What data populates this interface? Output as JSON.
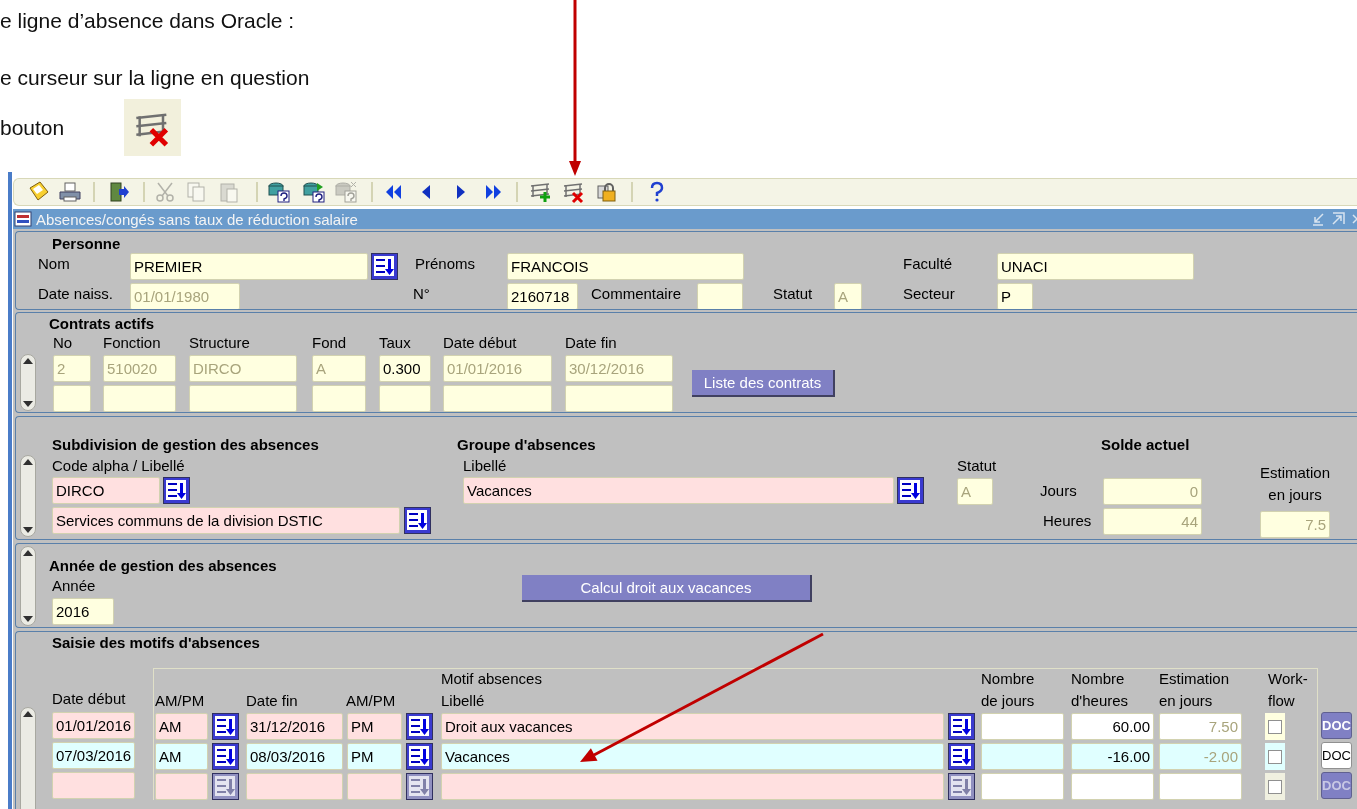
{
  "doc": {
    "lines": [
      "e ligne d’absence dans Oracle :",
      "e curseur sur la ligne en  question",
      "bouton"
    ]
  },
  "toolbar": [
    {
      "disabled": false
    },
    {
      "disabled": false
    },
    {
      "disabled": false
    },
    {
      "disabled": true
    },
    {
      "disabled": true
    },
    {
      "disabled": true
    },
    {
      "disabled": false
    },
    {
      "disabled": false
    },
    {
      "disabled": true
    },
    {
      "disabled": false
    },
    {
      "disabled": false
    },
    {
      "disabled": false
    },
    {
      "disabled": false
    },
    {
      "disabled": false
    },
    {
      "disabled": false
    },
    {
      "disabled": false
    },
    {
      "disabled": false
    }
  ],
  "window": {
    "title": "Absences/congés sans taux de réduction salaire"
  },
  "personne": {
    "title": "Personne",
    "fields": [
      {
        "label": "Nom",
        "value": "PREMIER",
        "kind": "optional",
        "disabled": false
      },
      {
        "label": "Prénoms",
        "value": "FRANCOIS",
        "kind": "optional",
        "disabled": false
      },
      {
        "label": "Faculté",
        "value": "UNACI",
        "kind": "optional",
        "disabled": false
      },
      {
        "label": "Date naiss.",
        "value": "01/01/1980",
        "kind": "optional",
        "disabled": true
      },
      {
        "label": "N°",
        "value": "2160718",
        "kind": "optional",
        "disabled": false
      },
      {
        "label": "Commentaire",
        "kind": "optional"
      },
      {
        "label": "Statut",
        "value": "A",
        "kind": "optional",
        "disabled": true
      },
      {
        "label": "Secteur",
        "value": "P",
        "kind": "optional",
        "disabled": false
      }
    ]
  },
  "contrats": {
    "title": "Contrats actifs",
    "columns": [
      "No",
      "Fonction",
      "Structure",
      "Fond",
      "Taux",
      "Date début",
      "Date fin"
    ],
    "rows": [
      {
        "blank": false,
        "cells": [
          {
            "value": "2",
            "disabled": true
          },
          {
            "value": "510020",
            "disabled": true
          },
          {
            "value": "DIRCO",
            "disabled": true
          },
          {
            "value": "A",
            "disabled": true
          },
          {
            "value": "0.300",
            "disabled": false
          },
          {
            "value": "01/01/2016",
            "disabled": true
          },
          {
            "value": "30/12/2016",
            "disabled": true
          }
        ]
      },
      {
        "blank": true
      }
    ],
    "button": "Liste des contrats"
  },
  "subdivision": {
    "title": "Subdivision de gestion des absences",
    "label": "Code alpha / Libellé",
    "code": "DIRCO",
    "libelle": "Services communs de la division DSTIC",
    "groupe": {
      "title": "Groupe d'absences",
      "label": "Libellé",
      "value": "Vacances"
    },
    "statut": {
      "label": "Statut",
      "value": "A",
      "disabled": true
    },
    "solde": {
      "title": "Solde actuel",
      "jours_label": "Jours",
      "jours": "0",
      "heures_label": "Heures",
      "heures": "44"
    },
    "estimation": {
      "lines": [
        "Estimation",
        "en jours"
      ],
      "value": "7.5"
    }
  },
  "annee": {
    "title": "Année de gestion des absences",
    "label": "Année",
    "value": "2016",
    "button": "Calcul droit aux vacances"
  },
  "saisie": {
    "title": "Saisie des motifs d'absences",
    "headers": [
      {
        "lines": [
          "Date début"
        ]
      },
      {
        "lines": [
          "AM/PM"
        ]
      },
      {
        "lines": [
          "Date fin"
        ]
      },
      {
        "lines": [
          "AM/PM"
        ]
      },
      {
        "lines": [
          "Motif absences",
          "Libellé"
        ]
      },
      {
        "lines": [
          "Nombre",
          "de jours"
        ]
      },
      {
        "lines": [
          "Nombre",
          "d'heures"
        ]
      },
      {
        "lines": [
          "Estimation",
          "en jours"
        ]
      },
      {
        "lines": [
          "Work-",
          "flow"
        ]
      }
    ],
    "rows": [
      {
        "selected": false,
        "blank": false,
        "cells": [
          {
            "value": "01/01/2016",
            "kind": "mandatory"
          },
          {
            "value": "AM",
            "kind": "mandatory"
          },
          {
            "value": "31/12/2016",
            "kind": "mandatory"
          },
          {
            "value": "PM",
            "kind": "mandatory"
          },
          {
            "value": "Droit aux vacances",
            "kind": "mandatory"
          },
          {
            "kind": "free"
          },
          {
            "value": "60.00",
            "kind": "free"
          },
          {
            "value": "7.50",
            "kind": "free",
            "disabled": true
          }
        ],
        "workflow": {
          "checked": false
        },
        "doc": "DOC"
      },
      {
        "selected": true,
        "blank": false,
        "cells": [
          {
            "value": "07/03/2016"
          },
          {
            "value": "AM"
          },
          {
            "value": "08/03/2016"
          },
          {
            "value": "PM"
          },
          {
            "value": "Vacances"
          },
          {},
          {
            "value": "-16.00"
          },
          {
            "value": "-2.00",
            "disabled": true
          }
        ],
        "workflow": {
          "checked": false
        },
        "doc": "DOC"
      },
      {
        "selected": false,
        "blank": true,
        "cells": [
          {
            "kind": "mandatory"
          },
          {
            "kind": "mandatory"
          },
          {
            "kind": "mandatory"
          },
          {
            "kind": "mandatory"
          },
          {
            "kind": "mandatory"
          },
          {
            "kind": "free"
          },
          {
            "kind": "free"
          },
          {
            "kind": "free"
          }
        ],
        "workflow": {
          "checked": false
        },
        "doc": "DOC"
      }
    ]
  }
}
